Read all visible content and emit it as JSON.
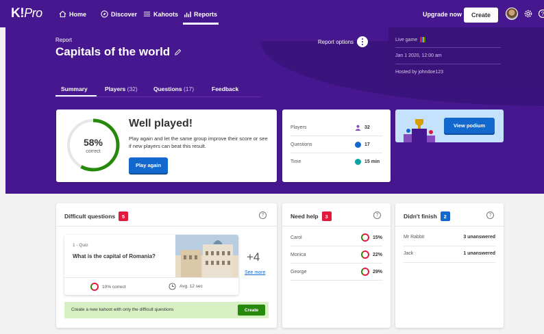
{
  "nav": {
    "logo_main": "K!",
    "logo_pro": "Pro",
    "items": [
      {
        "label": "Home",
        "icon": "home-icon"
      },
      {
        "label": "Discover",
        "icon": "compass-icon"
      },
      {
        "label": "Kahoots",
        "icon": "list-icon"
      },
      {
        "label": "Reports",
        "icon": "bar-chart-icon"
      }
    ],
    "active": "Reports",
    "upgrade_label": "Upgrade now",
    "create_label": "Create"
  },
  "report": {
    "small_label": "Report",
    "title": "Capitals of the world",
    "options_label": "Report options",
    "live_label": "Live game",
    "date": "Jan 1 2020, 12:00 am",
    "hosted_by": "Hosted by johndoe123"
  },
  "tabs": [
    {
      "label": "Summary",
      "count": ""
    },
    {
      "label": "Players",
      "count": "(32)"
    },
    {
      "label": "Questions",
      "count": "(17)"
    },
    {
      "label": "Feedback",
      "count": ""
    }
  ],
  "summary": {
    "percent": 58,
    "percent_label": "58%",
    "correct_label": "correct",
    "heading": "Well played!",
    "text": "Play again and let the same group improve their score or see if new players can beat this result.",
    "play_again_label": "Play again"
  },
  "stats": [
    {
      "label": "Players",
      "value": "32",
      "color": "#864cbf"
    },
    {
      "label": "Questions",
      "value": "17",
      "color": "#1368ce"
    },
    {
      "label": "Time",
      "value": "15 min",
      "color": "#0aa3a3"
    }
  ],
  "podium": {
    "button_label": "View podium"
  },
  "difficult": {
    "title": "Difficult questions",
    "count": "5",
    "question_type": "1 - Quiz",
    "question": "What is the capital of Romania?",
    "correct": "10% correct",
    "avg_time": "Avg. 12 sec",
    "more_count": "+4",
    "see_more": "See more",
    "create_text": "Create a new kahoot with only the difficult questions",
    "create_label": "Create"
  },
  "need_help": {
    "title": "Need help",
    "count": "3",
    "rows": [
      {
        "name": "Carol",
        "value": "15%"
      },
      {
        "name": "Monica",
        "value": "22%"
      },
      {
        "name": "George",
        "value": "29%"
      }
    ]
  },
  "didnt_finish": {
    "title": "Didn't finish",
    "count": "2",
    "rows": [
      {
        "name": "Mr Rabbit",
        "value": "3 unanswered"
      },
      {
        "name": "Jack",
        "value": "1 unanswered"
      }
    ]
  },
  "colors": {
    "purple": "#46178f",
    "red": "#e21b3c",
    "blue": "#1368ce",
    "green": "#26890c"
  }
}
